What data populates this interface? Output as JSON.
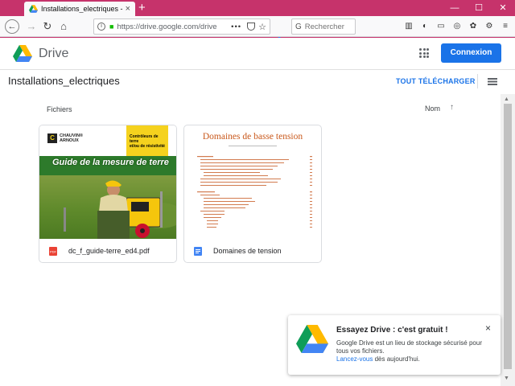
{
  "browser": {
    "tab_title": "Installations_electriques - Goog",
    "tab_close": "×",
    "new_tab": "+",
    "url": "https://drive.google.com/drive",
    "search_placeholder": "Rechercher",
    "window_controls": [
      "—",
      "☐",
      "✕"
    ]
  },
  "app": {
    "name": "Drive",
    "signin_label": "Connexion"
  },
  "folder": {
    "title": "Installations_electriques",
    "download_all_label": "TOUT TÉLÉCHARGER"
  },
  "files_section": {
    "label": "Fichiers",
    "sort_label": "Nom",
    "sort_arrow": "↑"
  },
  "files": [
    {
      "name": "dc_f_guide-terre_ed4.pdf",
      "type_icon": "pdf-icon",
      "type_color": "#ea4335",
      "thumb": {
        "brand_line1": "CHAUVIN®",
        "brand_line2": "ARNOUX",
        "brand_mark": "C",
        "box_line1": "Contrôleurs de terre",
        "box_line2": "et/ou de résistivité",
        "title": "Guide de la mesure de terre"
      }
    },
    {
      "name": "Domaines de tension",
      "type_icon": "doc-icon",
      "type_color": "#4285f4",
      "thumb": {
        "title": "Domaines de basse tension"
      }
    }
  ],
  "toast": {
    "title": "Essayez Drive : c'est gratuit !",
    "body": "Google Drive est un lieu de stockage sécurisé pour tous vos fichiers.",
    "link": "Lancez-vous",
    "body_end": " dès aujourd'hui.",
    "close": "×"
  },
  "colors": {
    "browser_frame": "#c6336b",
    "accent_blue": "#1a73e8"
  }
}
